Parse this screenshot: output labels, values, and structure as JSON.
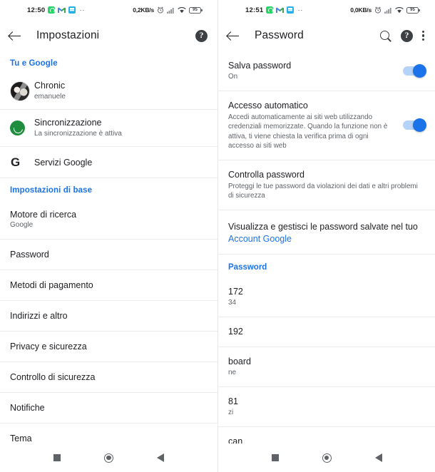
{
  "left": {
    "status_bar": {
      "time": "12:50",
      "network_speed": "0,2KB/s",
      "battery_level": "95",
      "app_icons": [
        "whatsapp-icon",
        "gmail-icon",
        "calendar-icon"
      ],
      "overflow_dots": "··"
    },
    "app_bar": {
      "back_label": "back-arrow",
      "title": "Impostazioni",
      "help_label": "?"
    },
    "sections": [
      {
        "header": "Tu e Google"
      },
      {
        "header": "Impostazioni di base"
      }
    ],
    "account": {
      "name": "Chronic",
      "subtitle": "emanuele"
    },
    "sync": {
      "name": "Sincronizzazione",
      "subtitle": "La sincronizzazione è attiva"
    },
    "google_services": {
      "name": "Servizi Google",
      "logo": "G"
    },
    "search_engine": {
      "name": "Motore di ricerca",
      "value": "Google"
    },
    "menu_items": [
      "Password",
      "Metodi di pagamento",
      "Indirizzi e altro",
      "Privacy e sicurezza",
      "Controllo di sicurezza",
      "Notifiche",
      "Tema"
    ]
  },
  "right": {
    "status_bar": {
      "time": "12:51",
      "network_speed": "0,0KB/s",
      "battery_level": "95",
      "app_icons": [
        "whatsapp-icon",
        "gmail-icon",
        "calendar-icon"
      ],
      "overflow_dots": "··"
    },
    "app_bar": {
      "title": "Password",
      "help_label": "?"
    },
    "save_password": {
      "title": "Salva password",
      "value": "On",
      "toggle_state": "on"
    },
    "auto_signin": {
      "title": "Accesso automatico",
      "description": "Accedi automaticamente ai siti web utilizzando credenziali memorizzate. Quando la funzione non è attiva, ti viene chiesta la verifica prima di ogni accesso ai siti web",
      "toggle_state": "on"
    },
    "check_passwords": {
      "title": "Controlla password",
      "description": "Proteggi le tue password da violazioni dei dati e altri problemi di sicurezza"
    },
    "account_link": {
      "text": "Visualizza e gestisci le password salvate nel tuo",
      "link": "Account Google"
    },
    "password_section_header": "Password",
    "passwords": [
      {
        "site": "172",
        "user": "34"
      },
      {
        "site": "192",
        "user": ""
      },
      {
        "site": "board",
        "user": "ne"
      },
      {
        "site": "81",
        "user": "zi"
      },
      {
        "site": "can",
        "user": ""
      }
    ]
  },
  "nav_bar": {
    "recents": "recents-square",
    "home": "home-circle",
    "back": "back-triangle"
  },
  "colors": {
    "accent": "#1a73e8",
    "sync_green": "#1e8e3e",
    "text_primary": "#202124",
    "text_secondary": "#5f6368"
  }
}
